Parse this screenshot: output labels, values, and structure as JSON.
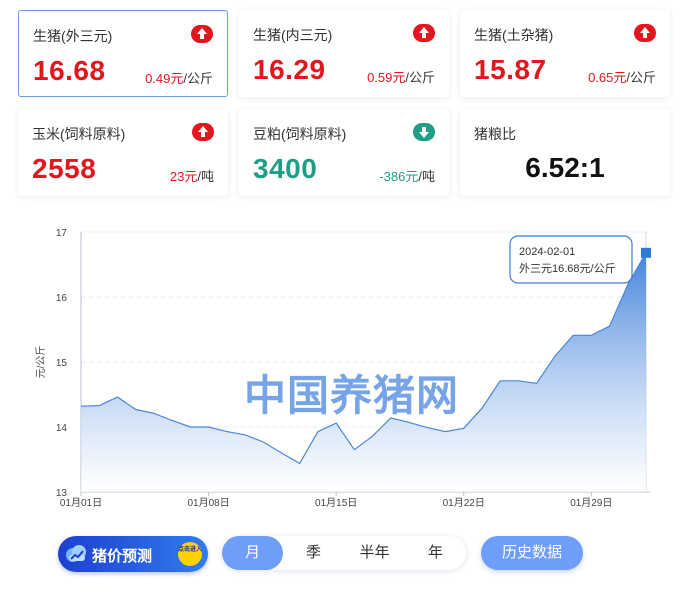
{
  "cards": [
    {
      "name": "生猪(外三元)",
      "price": "16.68",
      "change": "0.49元",
      "unit": "/公斤",
      "direction": "up"
    },
    {
      "name": "生猪(内三元)",
      "price": "16.29",
      "change": "0.59元",
      "unit": "/公斤",
      "direction": "up"
    },
    {
      "name": "生猪(土杂猪)",
      "price": "15.87",
      "change": "0.65元",
      "unit": "/公斤",
      "direction": "up"
    },
    {
      "name": "玉米(饲料原料)",
      "price": "2558",
      "change": "23元",
      "unit": "/吨",
      "direction": "up"
    },
    {
      "name": "豆粕(饲料原料)",
      "price": "3400",
      "change": "-386元",
      "unit": "/吨",
      "direction": "down"
    },
    {
      "name": "猪粮比",
      "value": "6.52:1"
    }
  ],
  "watermark": "中国养猪网",
  "tooltip": {
    "date": "2024-02-01",
    "text": "外三元16.68元/公斤"
  },
  "chart_data": {
    "type": "area",
    "ylabel": "元/公斤",
    "ylim": [
      13,
      17
    ],
    "yticks": [
      13,
      14,
      15,
      16,
      17
    ],
    "xticks": [
      "01月01日",
      "01月08日",
      "01月15日",
      "01月22日",
      "01月29日"
    ],
    "grid": true,
    "x": [
      "01-01",
      "01-02",
      "01-03",
      "01-04",
      "01-05",
      "01-06",
      "01-07",
      "01-08",
      "01-09",
      "01-10",
      "01-11",
      "01-12",
      "01-13",
      "01-14",
      "01-15",
      "01-16",
      "01-17",
      "01-18",
      "01-19",
      "01-20",
      "01-21",
      "01-22",
      "01-23",
      "01-24",
      "01-25",
      "01-26",
      "01-27",
      "01-28",
      "01-29",
      "01-30",
      "01-31",
      "02-01"
    ],
    "series": [
      {
        "values": [
          14.32,
          14.33,
          14.46,
          14.27,
          14.21,
          14.1,
          14.0,
          14.0,
          13.93,
          13.88,
          13.77,
          13.6,
          13.44,
          13.93,
          14.06,
          13.65,
          13.86,
          14.14,
          14.07,
          13.99,
          13.93,
          13.98,
          14.29,
          14.71,
          14.71,
          14.67,
          15.09,
          15.41,
          15.41,
          15.55,
          16.19,
          16.68
        ]
      }
    ]
  },
  "controls": {
    "predict_label": "猪价预测",
    "predict_badge": "点击进入",
    "periods": [
      "月",
      "季",
      "半年",
      "年"
    ],
    "selected_period": "月",
    "history_label": "历史数据"
  },
  "colors": {
    "up": "#e3161e",
    "down": "#1f9e86",
    "line": "#4a86dd",
    "accent": "#6f9dfa"
  }
}
